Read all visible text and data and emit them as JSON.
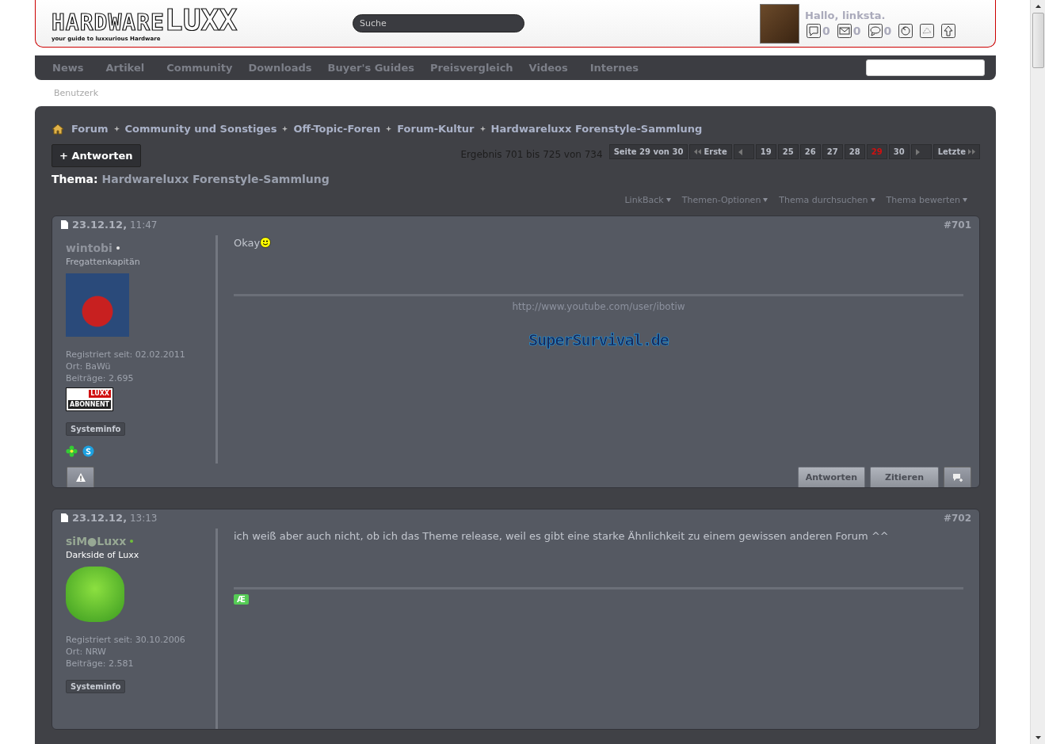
{
  "header": {
    "logo": {
      "main": "HARDWARE",
      "accent": "LUXX",
      "tagline": "your guide to luxxurious Hardware"
    },
    "search": {
      "placeholder": "Suche"
    },
    "greeting": "Hallo, linksta.",
    "counters": [
      {
        "kind": "notes",
        "count": "0"
      },
      {
        "kind": "mail",
        "count": "0"
      },
      {
        "kind": "chat",
        "count": "0"
      },
      {
        "kind": "refresh"
      },
      {
        "kind": "network"
      },
      {
        "kind": "up"
      }
    ]
  },
  "nav": {
    "items": [
      "News",
      "Artikel",
      "Community",
      "Downloads",
      "Buyer's Guides",
      "Preisvergleich",
      "Videos",
      "Internes"
    ],
    "sub_label": "Benutzerk"
  },
  "breadcrumb": [
    "Forum",
    "Community und Sonstiges",
    "Off-Topic-Foren",
    "Forum-Kultur",
    "Hardwareluxx Forenstyle-Sammlung"
  ],
  "reply_button": "+ Antworten",
  "results": "Ergebnis 701 bis 725 von 734",
  "pagination": [
    {
      "kind": "info",
      "label": "Seite 29 von 30",
      "selected": false
    },
    {
      "kind": "first",
      "label": "Erste",
      "selected": false
    },
    {
      "kind": "prev"
    },
    {
      "kind": "page",
      "label": "19",
      "selected": false
    },
    {
      "kind": "page",
      "label": "25",
      "selected": false
    },
    {
      "kind": "page",
      "label": "26",
      "selected": false
    },
    {
      "kind": "page",
      "label": "27",
      "selected": false
    },
    {
      "kind": "page",
      "label": "28",
      "selected": false
    },
    {
      "kind": "page",
      "label": "29",
      "selected": true
    },
    {
      "kind": "page",
      "label": "30",
      "selected": false
    },
    {
      "kind": "next"
    },
    {
      "kind": "last",
      "label": "Letzte",
      "selected": false
    }
  ],
  "thread": {
    "label": "Thema:",
    "title": "Hardwareluxx Forenstyle-Sammlung"
  },
  "thread_tools": [
    "LinkBack",
    "Themen-Optionen",
    "Thema durchsuchen",
    "Thema bewerten"
  ],
  "posts": [
    {
      "date": "23.12.12,",
      "time": "11:47",
      "number": "#701",
      "username": "wintobi",
      "color": "#e8e8e8",
      "rank": "Fregattenkapitän",
      "rank_highlight": false,
      "stats": [
        "Registriert seit: 02.02.2011",
        "Ort: BaWü",
        "Beiträge: 2.695"
      ],
      "badge": {
        "logo": "LUXX",
        "label": "ABONNENT"
      },
      "systeminfo": "Systeminfo",
      "contacts": true,
      "message": "Okay",
      "smiley": true,
      "signature": {
        "kind": "link",
        "url": "http://www.youtube.com/user/ibotiw",
        "banner": "SuperSurvival.de"
      },
      "actions": [
        "Antworten",
        "Zitieren"
      ]
    },
    {
      "date": "23.12.12,",
      "time": "13:13",
      "number": "#702",
      "username": "siM●Luxx",
      "color": "#6fbf3a",
      "rank": "Darkside of Luxx",
      "rank_highlight": true,
      "stats": [
        "Registriert seit: 30.10.2006",
        "Ort: NRW",
        "Beiträge: 2.581"
      ],
      "systeminfo": "Systeminfo",
      "contacts": false,
      "message": "ich weiß aber auch nicht, ob ich das Theme release, weil es gibt eine starke Ähnlichkeit zu einem gewissen anderen Forum ^^",
      "smiley": false,
      "signature": {
        "kind": "icon",
        "glyph": "Æ"
      }
    }
  ]
}
